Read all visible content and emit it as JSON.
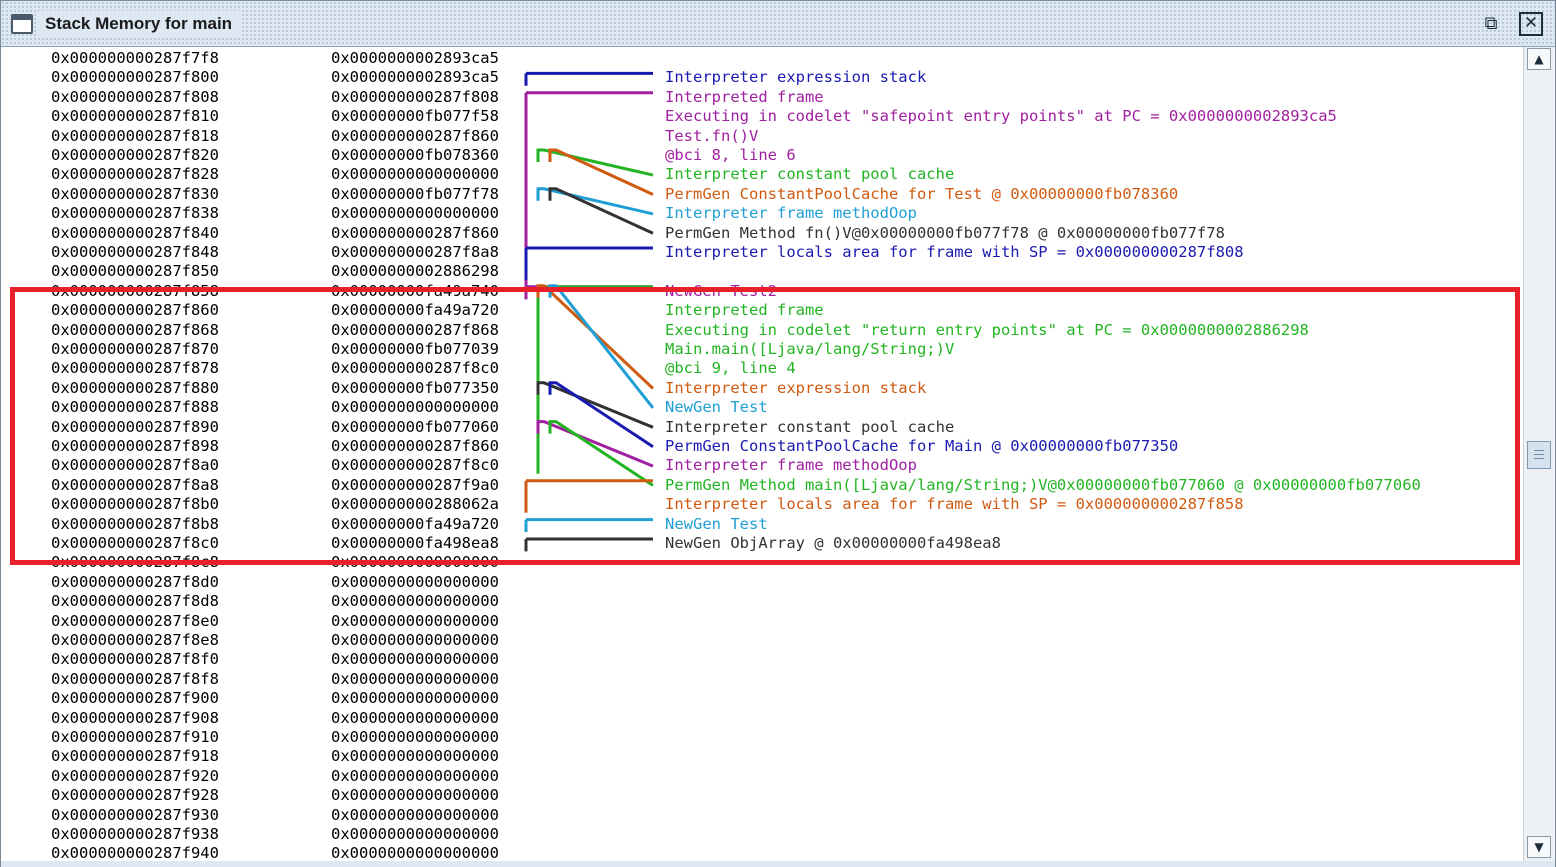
{
  "window": {
    "title": "Stack Memory for main",
    "restore_glyph": "⧉",
    "close_glyph": "✕"
  },
  "rows": [
    {
      "addr": "0x000000000287f7f8",
      "val": "0x0000000002893ca5"
    },
    {
      "addr": "0x000000000287f800",
      "val": "0x0000000002893ca5"
    },
    {
      "addr": "0x000000000287f808",
      "val": "0x000000000287f808"
    },
    {
      "addr": "0x000000000287f810",
      "val": "0x00000000fb077f58"
    },
    {
      "addr": "0x000000000287f818",
      "val": "0x000000000287f860"
    },
    {
      "addr": "0x000000000287f820",
      "val": "0x00000000fb078360"
    },
    {
      "addr": "0x000000000287f828",
      "val": "0x0000000000000000"
    },
    {
      "addr": "0x000000000287f830",
      "val": "0x00000000fb077f78"
    },
    {
      "addr": "0x000000000287f838",
      "val": "0x0000000000000000"
    },
    {
      "addr": "0x000000000287f840",
      "val": "0x000000000287f860"
    },
    {
      "addr": "0x000000000287f848",
      "val": "0x000000000287f8a8"
    },
    {
      "addr": "0x000000000287f850",
      "val": "0x0000000002886298"
    },
    {
      "addr": "0x000000000287f858",
      "val": "0x00000000fa49a740"
    },
    {
      "addr": "0x000000000287f860",
      "val": "0x00000000fa49a720"
    },
    {
      "addr": "0x000000000287f868",
      "val": "0x000000000287f868"
    },
    {
      "addr": "0x000000000287f870",
      "val": "0x00000000fb077039"
    },
    {
      "addr": "0x000000000287f878",
      "val": "0x000000000287f8c0"
    },
    {
      "addr": "0x000000000287f880",
      "val": "0x00000000fb077350"
    },
    {
      "addr": "0x000000000287f888",
      "val": "0x0000000000000000"
    },
    {
      "addr": "0x000000000287f890",
      "val": "0x00000000fb077060"
    },
    {
      "addr": "0x000000000287f898",
      "val": "0x000000000287f860"
    },
    {
      "addr": "0x000000000287f8a0",
      "val": "0x000000000287f8c0"
    },
    {
      "addr": "0x000000000287f8a8",
      "val": "0x000000000287f9a0"
    },
    {
      "addr": "0x000000000287f8b0",
      "val": "0x000000000288062a"
    },
    {
      "addr": "0x000000000287f8b8",
      "val": "0x00000000fa49a720"
    },
    {
      "addr": "0x000000000287f8c0",
      "val": "0x00000000fa498ea8"
    },
    {
      "addr": "0x000000000287f8c8",
      "val": "0x0000000000000000"
    },
    {
      "addr": "0x000000000287f8d0",
      "val": "0x0000000000000000"
    },
    {
      "addr": "0x000000000287f8d8",
      "val": "0x0000000000000000"
    },
    {
      "addr": "0x000000000287f8e0",
      "val": "0x0000000000000000"
    },
    {
      "addr": "0x000000000287f8e8",
      "val": "0x0000000000000000"
    },
    {
      "addr": "0x000000000287f8f0",
      "val": "0x0000000000000000"
    },
    {
      "addr": "0x000000000287f8f8",
      "val": "0x0000000000000000"
    },
    {
      "addr": "0x000000000287f900",
      "val": "0x0000000000000000"
    },
    {
      "addr": "0x000000000287f908",
      "val": "0x0000000000000000"
    },
    {
      "addr": "0x000000000287f910",
      "val": "0x0000000000000000"
    },
    {
      "addr": "0x000000000287f918",
      "val": "0x0000000000000000"
    },
    {
      "addr": "0x000000000287f920",
      "val": "0x0000000000000000"
    },
    {
      "addr": "0x000000000287f928",
      "val": "0x0000000000000000"
    },
    {
      "addr": "0x000000000287f930",
      "val": "0x0000000000000000"
    },
    {
      "addr": "0x000000000287f938",
      "val": "0x0000000000000000"
    },
    {
      "addr": "0x000000000287f940",
      "val": "0x0000000000000000"
    }
  ],
  "annotations": [
    {
      "row": 1,
      "text": "Interpreter expression stack",
      "color": "#1a1ab0"
    },
    {
      "row": 2,
      "text": "Interpreted frame",
      "color": "#a020a0"
    },
    {
      "row": 3,
      "text": "Executing in codelet \"safepoint entry points\" at PC = 0x0000000002893ca5",
      "color": "#a020a0"
    },
    {
      "row": 4,
      "text": "Test.fn()V",
      "color": "#a020a0"
    },
    {
      "row": 5,
      "text": "@bci 8, line 6",
      "color": "#a020a0"
    },
    {
      "row": 6,
      "text": "Interpreter constant pool cache",
      "color": "#22b422"
    },
    {
      "row": 7,
      "text": "PermGen ConstantPoolCache for Test @ 0x00000000fb078360",
      "color": "#d05a10"
    },
    {
      "row": 8,
      "text": "Interpreter frame methodOop",
      "color": "#1f9fd4"
    },
    {
      "row": 9,
      "text": "PermGen Method fn()V@0x00000000fb077f78 @ 0x00000000fb077f78",
      "color": "#333333"
    },
    {
      "row": 10,
      "text": "Interpreter locals area for frame with SP = 0x000000000287f808",
      "color": "#1a1ab0"
    },
    {
      "row": 12,
      "text": "NewGen Test2",
      "color": "#a020a0"
    },
    {
      "row": 13,
      "text": "Interpreted frame",
      "color": "#22b422"
    },
    {
      "row": 14,
      "text": "Executing in codelet \"return entry points\" at PC = 0x0000000002886298",
      "color": "#22b422"
    },
    {
      "row": 15,
      "text": "Main.main([Ljava/lang/String;)V",
      "color": "#22b422"
    },
    {
      "row": 16,
      "text": "@bci 9, line 4",
      "color": "#22b422"
    },
    {
      "row": 17,
      "text": "Interpreter expression stack",
      "color": "#d05a10"
    },
    {
      "row": 18,
      "text": "NewGen Test",
      "color": "#1f9fd4"
    },
    {
      "row": 19,
      "text": "Interpreter constant pool cache",
      "color": "#333333"
    },
    {
      "row": 20,
      "text": "PermGen ConstantPoolCache for Main @ 0x00000000fb077350",
      "color": "#1a1ab0"
    },
    {
      "row": 21,
      "text": "Interpreter frame methodOop",
      "color": "#a020a0"
    },
    {
      "row": 22,
      "text": "PermGen Method main([Ljava/lang/String;)V@0x00000000fb077060 @ 0x00000000fb077060",
      "color": "#22b422"
    },
    {
      "row": 23,
      "text": "Interpreter locals area for frame with SP = 0x000000000287f858",
      "color": "#d05a10"
    },
    {
      "row": 24,
      "text": "NewGen Test",
      "color": "#1f9fd4"
    },
    {
      "row": 25,
      "text": "NewGen ObjArray @ 0x00000000fa498ea8",
      "color": "#333333"
    }
  ],
  "connectors": [
    {
      "kind": "bracket",
      "from": 1,
      "to": 1,
      "target": 1,
      "color": "#1a1ab0"
    },
    {
      "kind": "bracket",
      "from": 2,
      "to": 12,
      "target": 2,
      "color": "#a020a0"
    },
    {
      "kind": "pointer",
      "row": 5,
      "target": 6,
      "color": "#22b422"
    },
    {
      "kind": "pointer",
      "row": 5,
      "target": 7,
      "color": "#d05a10"
    },
    {
      "kind": "pointer",
      "row": 7,
      "target": 8,
      "color": "#1f9fd4"
    },
    {
      "kind": "pointer",
      "row": 7,
      "target": 9,
      "color": "#333333"
    },
    {
      "kind": "bracket",
      "from": 10,
      "to": 11,
      "target": 10,
      "color": "#1a1ab0"
    },
    {
      "kind": "bracket",
      "from": 12,
      "to": 12,
      "target": 12,
      "color": "#a020a0"
    },
    {
      "kind": "bracket",
      "from": 12,
      "to": 21,
      "target": 13,
      "color": "#22b422"
    },
    {
      "kind": "pointer",
      "row": 12,
      "target": 17,
      "color": "#d05a10"
    },
    {
      "kind": "pointer",
      "row": 12,
      "target": 18,
      "color": "#1f9fd4"
    },
    {
      "kind": "pointer",
      "row": 17,
      "target": 19,
      "color": "#333333"
    },
    {
      "kind": "pointer",
      "row": 17,
      "target": 20,
      "color": "#1a1ab0"
    },
    {
      "kind": "pointer",
      "row": 19,
      "target": 21,
      "color": "#a020a0"
    },
    {
      "kind": "pointer",
      "row": 19,
      "target": 22,
      "color": "#22b422"
    },
    {
      "kind": "bracket",
      "from": 22,
      "to": 23,
      "target": 23,
      "color": "#d05a10"
    },
    {
      "kind": "bracket",
      "from": 24,
      "to": 24,
      "target": 24,
      "color": "#1f9fd4"
    },
    {
      "kind": "bracket",
      "from": 25,
      "to": 25,
      "target": 25,
      "color": "#333333"
    }
  ],
  "highlight": {
    "from": 13,
    "to": 25,
    "color": "#e8202a"
  },
  "scrollbar": {
    "up_glyph": "▲",
    "down_glyph": "▼",
    "thumb_fraction": 0.5
  }
}
